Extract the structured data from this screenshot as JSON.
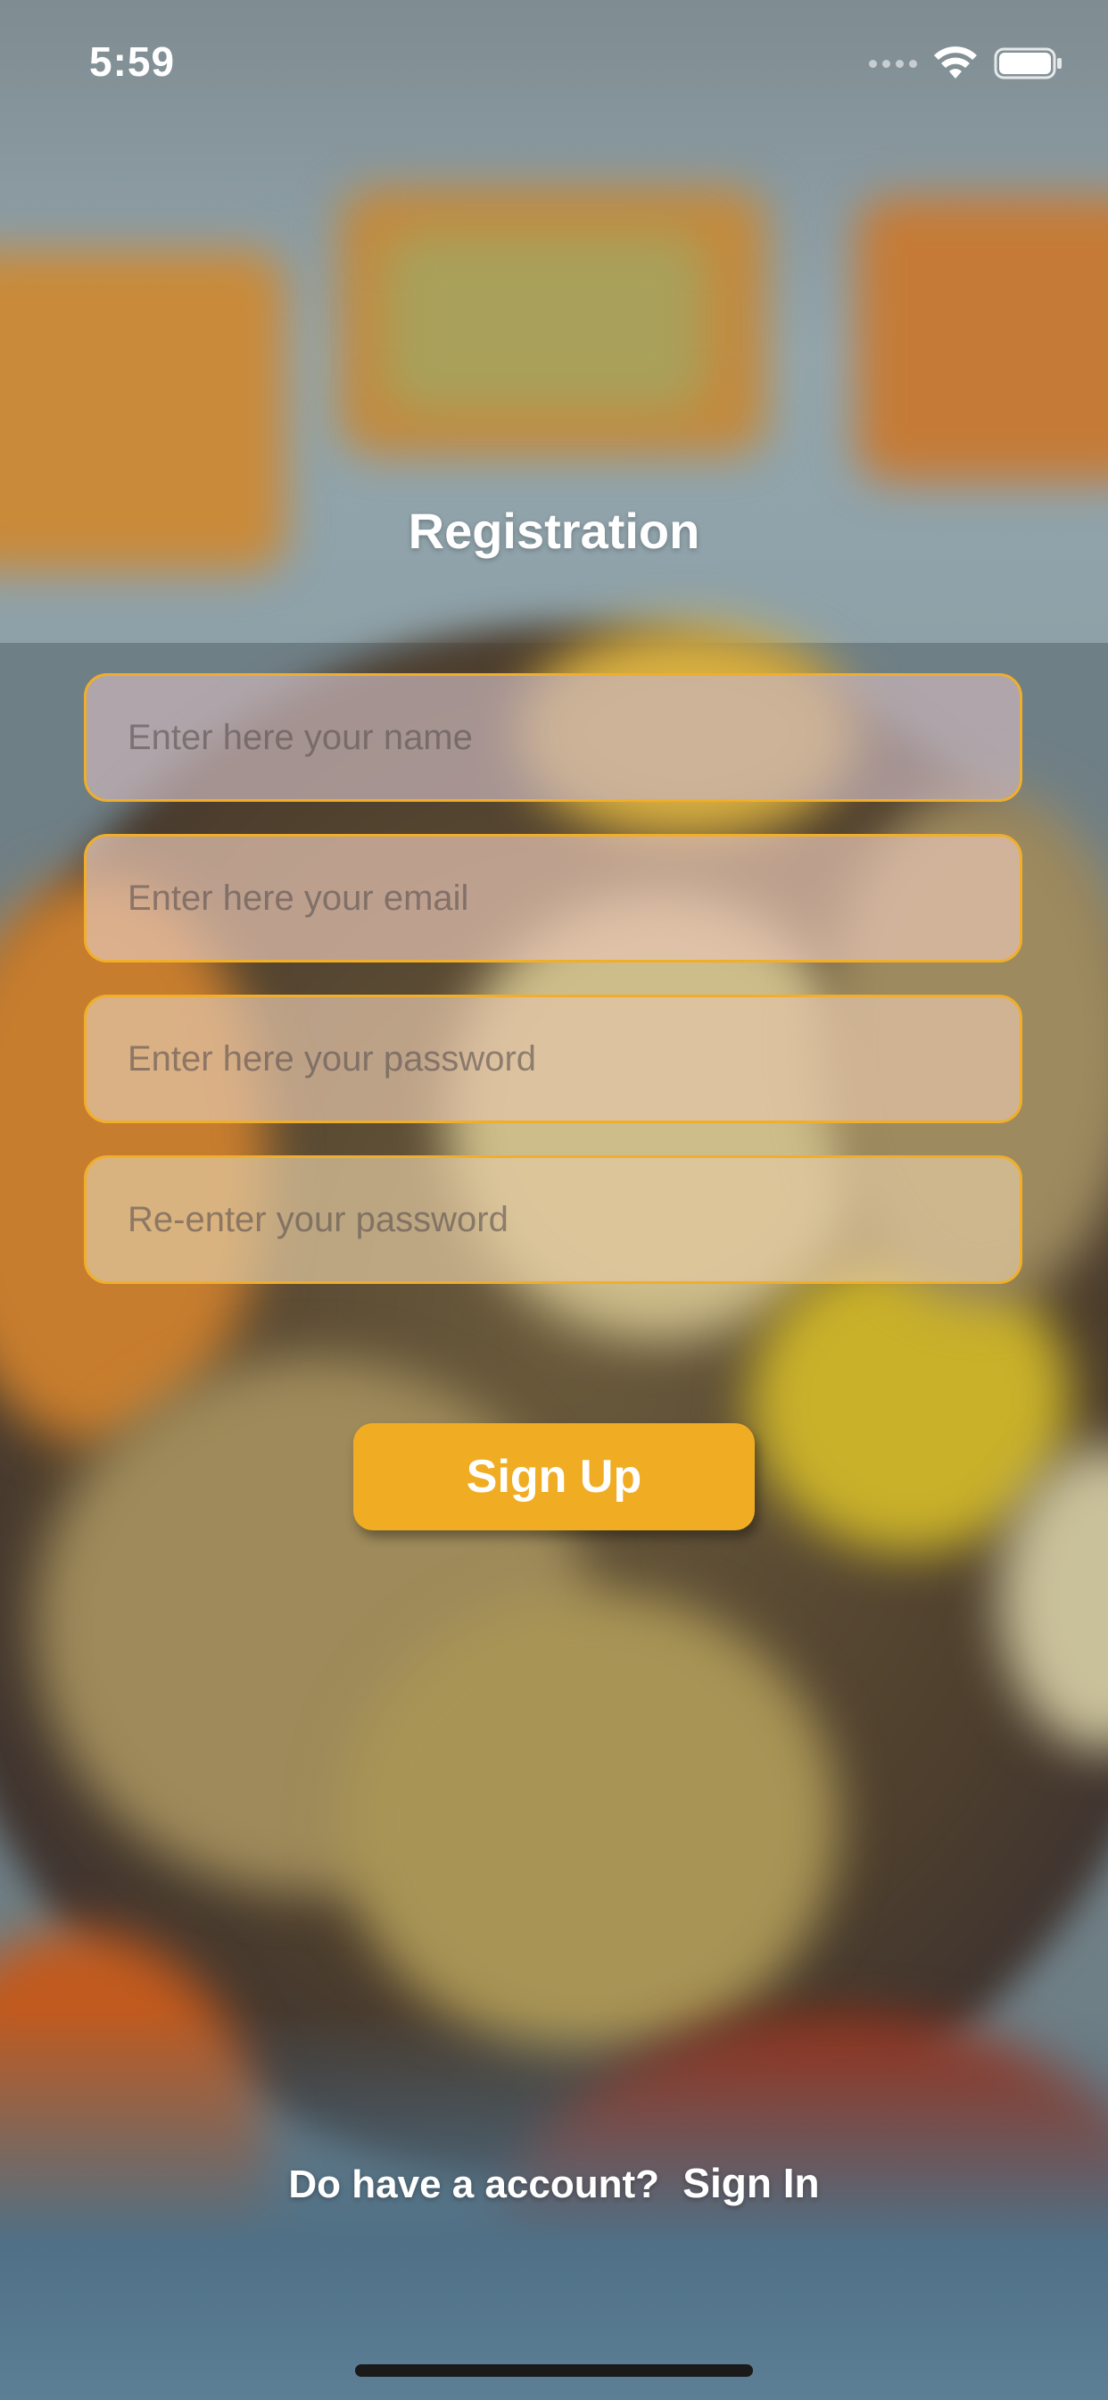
{
  "status_bar": {
    "time": "5:59"
  },
  "page": {
    "title": "Registration"
  },
  "form": {
    "name_placeholder": "Enter here your name",
    "email_placeholder": "Enter here your email",
    "password_placeholder": "Enter here your password",
    "confirm_password_placeholder": "Re-enter your password",
    "submit_label": "Sign Up"
  },
  "footer": {
    "prompt": "Do have a account?",
    "link_label": "Sign In"
  },
  "colors": {
    "accent": "#f0ad24",
    "field_border": "#f0ae2a",
    "text_light": "#ffffff"
  },
  "icons": [
    "cellular-signal-icon",
    "wifi-icon",
    "battery-icon"
  ]
}
